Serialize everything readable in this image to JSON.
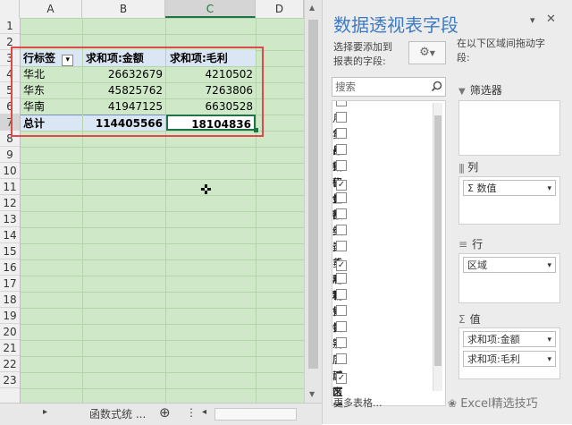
{
  "sheet": {
    "columns": [
      "A",
      "B",
      "C",
      "D"
    ],
    "rows": [
      "1",
      "2",
      "3",
      "4",
      "5",
      "6",
      "7",
      "8",
      "9",
      "10",
      "11",
      "12",
      "13",
      "14",
      "15",
      "16",
      "17",
      "18",
      "19",
      "20",
      "21",
      "22",
      "23"
    ],
    "pivot": {
      "header": [
        "行标签",
        "求和项:金额",
        "求和项:毛利"
      ],
      "filter_glyph": "▾",
      "data": [
        [
          "华北",
          "26632679",
          "4210502"
        ],
        [
          "华东",
          "45825762",
          "7263806"
        ],
        [
          "华南",
          "41947125",
          "6630528"
        ]
      ],
      "total": [
        "总计",
        "114405566",
        "18104836"
      ]
    },
    "cursor_glyph": "✜",
    "tabs": {
      "prev_arrow": "▸",
      "sheet_name": "函数式统 ...",
      "add_glyph": "⊕",
      "menu_glyph": "⋮",
      "left_arrow": "◂"
    }
  },
  "panel": {
    "title": "数据透视表字段",
    "close_glyph": "✕",
    "dropdown_glyph": "▾",
    "choose_label_line1": "选择要添加到",
    "choose_label_line2": "报表的字段:",
    "drag_label_line1": "在以下区域间拖动字",
    "drag_label_line2": "段:",
    "search_placeholder": "搜索",
    "fields": [
      {
        "label": "月年号",
        "checked": false
      },
      {
        "label": "货品代码",
        "checked": false
      },
      {
        "label": "日期",
        "checked": false
      },
      {
        "label": "销售量",
        "checked": false
      },
      {
        "label": "售价",
        "checked": false
      },
      {
        "label": "金额",
        "checked": true
      },
      {
        "label": "品类",
        "checked": false
      },
      {
        "label": "细类",
        "checked": false
      },
      {
        "label": "进货成本",
        "checked": false
      },
      {
        "label": "毛利率",
        "checked": false
      },
      {
        "label": "毛利",
        "checked": true
      },
      {
        "label": "销售员",
        "checked": false
      },
      {
        "label": "姓名",
        "checked": false
      },
      {
        "label": "性别",
        "checked": false
      },
      {
        "label": "学历",
        "checked": false
      },
      {
        "label": "店面",
        "checked": false
      },
      {
        "label": "城市",
        "checked": false
      },
      {
        "label": "区域",
        "checked": true
      }
    ],
    "more_tables": "更多表格...",
    "filters_label": "筛选器",
    "columns_label": "列",
    "columns_item": "Σ 数值",
    "rows_label": "行",
    "rows_item": "区域",
    "values_label": "值",
    "values_items": [
      "求和项:金额",
      "求和项:毛利"
    ],
    "watermark": "Excel精选技巧",
    "colors": {
      "accent": "#3c7bc3",
      "sheet_bg": "#cfe8c8",
      "highlight": "#e0494b",
      "check": "#4a4a4a"
    }
  }
}
